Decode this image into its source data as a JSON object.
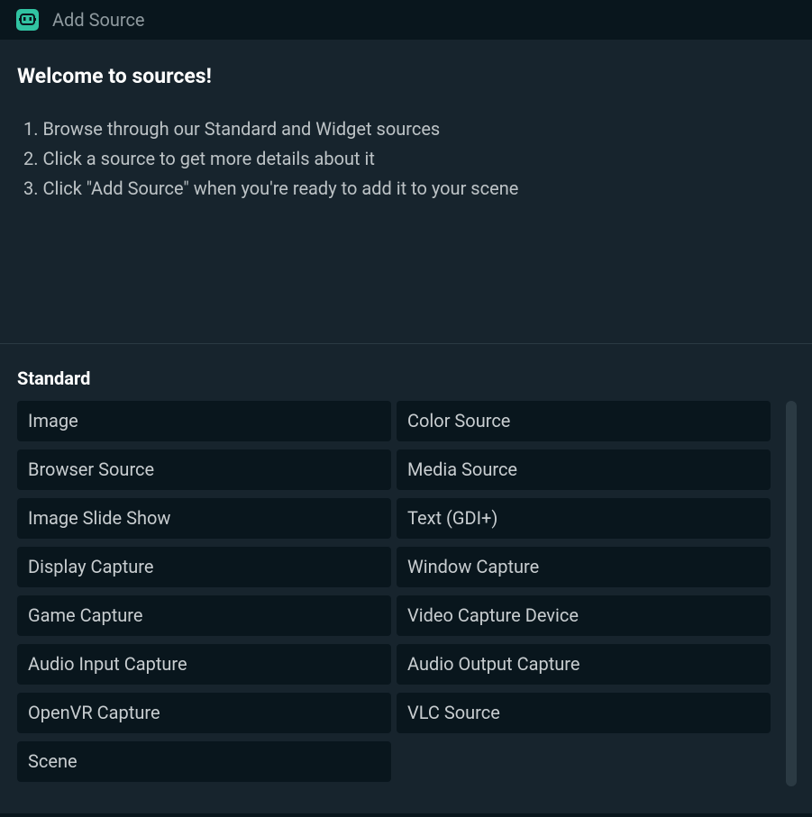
{
  "window": {
    "title": "Add Source",
    "icon": "streamlabs-robot-icon",
    "accent_color": "#31c3a2"
  },
  "welcome": {
    "title": "Welcome to sources!",
    "steps": [
      "1. Browse through our Standard and Widget sources",
      "2. Click a source to get more details about it",
      "3. Click \"Add Source\" when you're ready to add it to your scene"
    ]
  },
  "standard": {
    "title": "Standard",
    "sources": [
      "Image",
      "Color Source",
      "Browser Source",
      "Media Source",
      "Image Slide Show",
      "Text (GDI+)",
      "Display Capture",
      "Window Capture",
      "Game Capture",
      "Video Capture Device",
      "Audio Input Capture",
      "Audio Output Capture",
      "OpenVR Capture",
      "VLC Source",
      "Scene"
    ]
  }
}
